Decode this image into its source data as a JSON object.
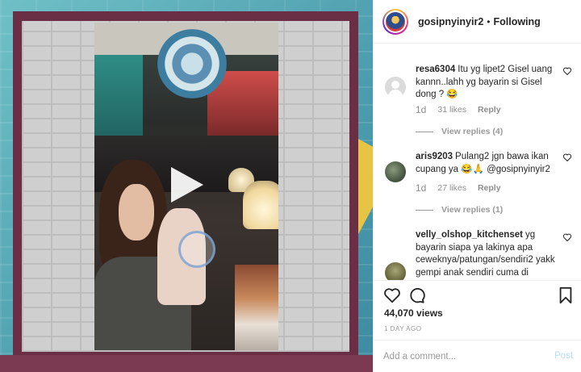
{
  "header": {
    "username": "gosipnyinyir2",
    "separator": "•",
    "follow_label": "Following"
  },
  "comments": [
    {
      "username": "resa6304",
      "text": "Itu yg lipet2 Gisel uang kannn..lahh yg bayarin si Gisel dong ? 😂",
      "time": "1d",
      "likes": "31 likes",
      "reply_label": "Reply",
      "view_replies": "View replies (4)"
    },
    {
      "username": "aris9203",
      "text": "Pulang2 jgn bawa ikan cupang ya 😂🙏 @gosipnyinyir2",
      "time": "1d",
      "likes": "27 likes",
      "reply_label": "Reply",
      "view_replies": "View replies (1)"
    },
    {
      "username": "velly_olshop_kitchenset",
      "text": "yg bayarin siapa ya lakinya apa ceweknya/patungan/sendiri2 yakk gempi anak sendiri cuma di bali..ini sama anak orang selalu keluar"
    }
  ],
  "actions": {
    "views": "44,070 views",
    "posted": "1 DAY AGO"
  },
  "add_comment": {
    "placeholder": "Add a comment...",
    "post_label": "Post"
  },
  "icons": {
    "play": "play-icon",
    "heart": "heart-icon",
    "comment": "comment-icon",
    "bookmark": "bookmark-icon"
  },
  "colors": {
    "post_disabled": "#b2dffc",
    "secondary_text": "#8e8e8e",
    "frame": "#6a2f45",
    "teal_bg": "#5aa9b6"
  }
}
